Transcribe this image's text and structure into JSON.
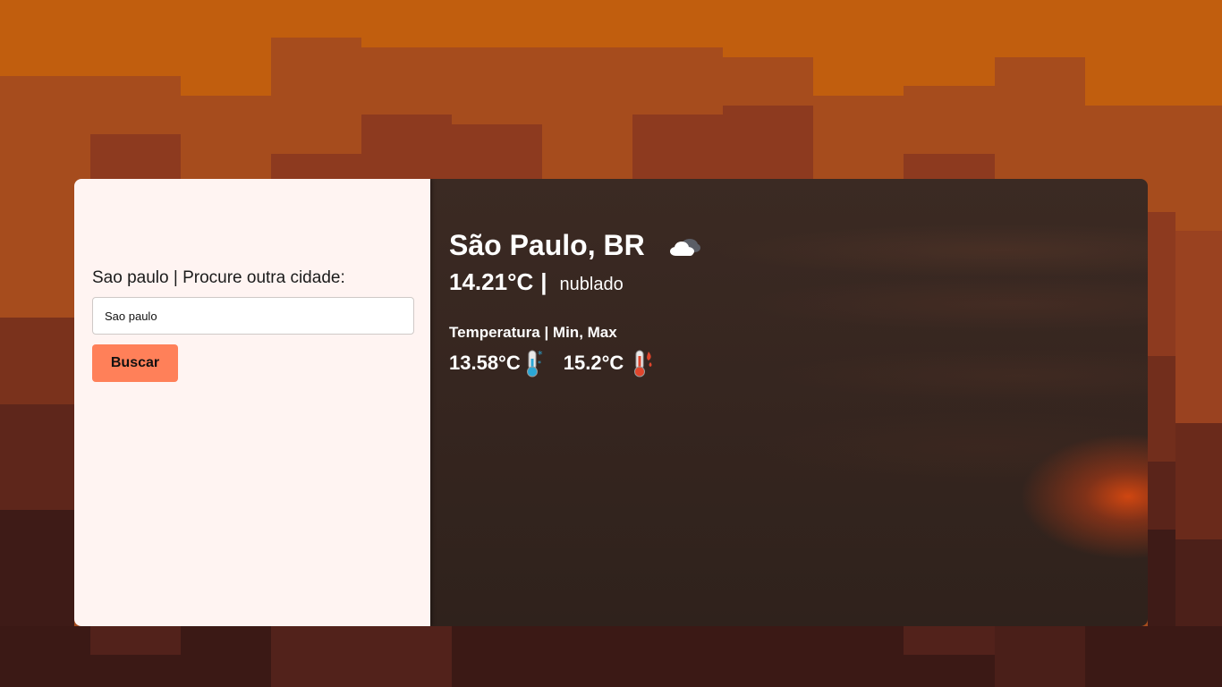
{
  "search": {
    "label": "Sao paulo | Procure outra cidade:",
    "input_value": "Sao paulo",
    "button_label": "Buscar"
  },
  "weather": {
    "city": "São Paulo, BR",
    "icon": "cloud-icon",
    "temperature": "14.21°C",
    "separator": "|",
    "description": "nublado",
    "minmax_title": "Temperatura | Min, Max",
    "min_temp": "13.58°C",
    "min_icon": "cold-thermometer-icon",
    "max_temp": "15.2°C",
    "max_icon": "hot-thermometer-icon"
  },
  "colors": {
    "accent_button": "#ff8059",
    "left_panel": "#fff4f2",
    "right_panel": "#35251f",
    "background": "#c15e0e"
  }
}
